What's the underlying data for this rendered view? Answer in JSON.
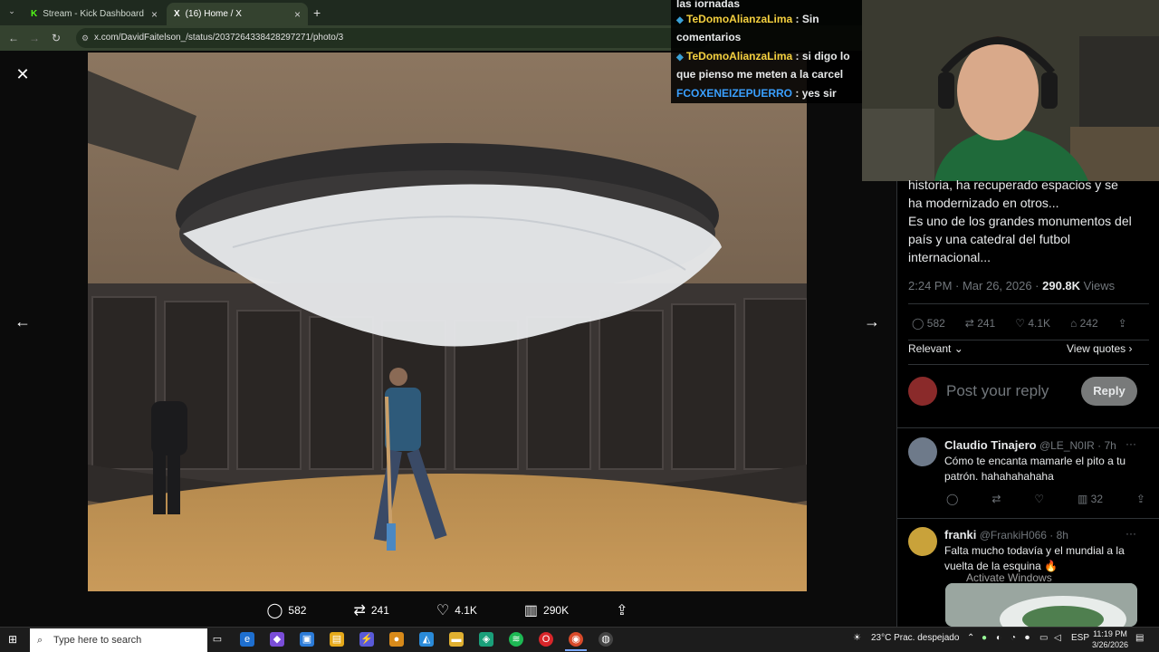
{
  "browser": {
    "tabs": [
      {
        "label": "Stream - Kick Dashboard",
        "favicon": "K"
      },
      {
        "label": "(16) Home / X",
        "favicon": "X"
      }
    ],
    "new_tab": "+",
    "url": "x.com/DavidFaitelson_/status/2037264338428297271/photo/3"
  },
  "chat": {
    "messages": [
      {
        "user": "",
        "text": "las jornadas"
      },
      {
        "user": "TeDomoAlianzaLima",
        "text": ": Sin comentarios"
      },
      {
        "user": "TeDomoAlianzaLima",
        "text": ": si digo lo que pienso me meten a la carcel"
      },
      {
        "user": "FCOXENEIZEPUERRO",
        "text": ": yes sir"
      }
    ]
  },
  "viewer": {
    "actions": {
      "replies": "582",
      "reposts": "241",
      "likes": "4.1K",
      "views": "290K"
    }
  },
  "panel": {
    "tweet_lines": [
      "historia, ha recuperado espacios y se",
      "ha modernizado en otros...",
      "Es uno de los grandes monumentos del",
      "país y una catedral del futbol",
      "internacional..."
    ],
    "time": "2:24 PM · Mar 26, 2026 · ",
    "views_count": "290.8K",
    "views_label": " Views",
    "stats": {
      "replies": "582",
      "reposts": "241",
      "likes": "4.1K",
      "bookmarks": "242"
    },
    "sort_label": "Relevant",
    "view_quotes": "View quotes",
    "reply_placeholder": "Post your reply",
    "reply_button": "Reply",
    "replies": [
      {
        "name": "Claudio Tinajero",
        "handle": "@LE_N0IR · 7h",
        "text": "Cómo te encanta mamarle el pito a tu patrón. hahahahahaha",
        "views": "32"
      },
      {
        "name": "franki",
        "handle": "@FrankiH066 · 8h",
        "text": "Falta mucho todavía y el mundial a la vuelta de la esquina 🔥"
      }
    ],
    "watermark": "Activate Windows"
  },
  "taskbar": {
    "search_placeholder": "Type here to search",
    "weather": "23°C  Prac. despejado",
    "lang": "ESP",
    "time": "11:19 PM",
    "date": "3/26/2026"
  }
}
